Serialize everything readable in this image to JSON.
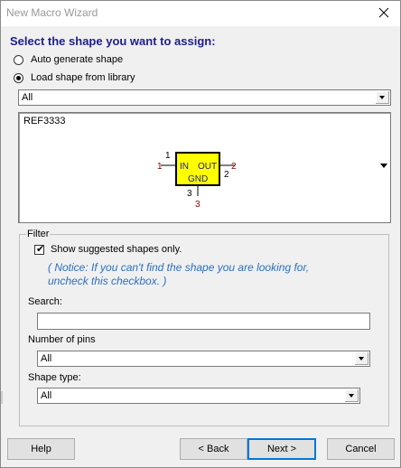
{
  "window": {
    "title": "New Macro Wizard"
  },
  "heading": "Select the shape you want to assign:",
  "options": {
    "auto": "Auto generate shape",
    "library": "Load shape from library",
    "selected": "library"
  },
  "library_combo": {
    "value": "All"
  },
  "preview": {
    "shape_name": "REF3333",
    "symbol": {
      "pins": [
        {
          "number": "1",
          "name": "IN"
        },
        {
          "number": "2",
          "name": "OUT"
        },
        {
          "number": "3",
          "name": "GND"
        }
      ],
      "body_color": "#ffff00",
      "pin_number_color": "#8b0000"
    }
  },
  "filter": {
    "legend": "Filter",
    "suggested_label": "Show suggested shapes only.",
    "suggested_checked": true,
    "notice": "( Notice: If you can't find the shape you are looking for, uncheck this checkbox. )",
    "search_label": "Search:",
    "search_value": "",
    "pins_label": "Number of pins",
    "pins_value": "All",
    "type_label": "Shape type:",
    "type_value": "All"
  },
  "buttons": {
    "help": "Help",
    "back": "< Back",
    "next": "Next >",
    "cancel": "Cancel"
  },
  "colors": {
    "heading": "#1e1e8c",
    "notice": "#2a6fc1",
    "default_button_border": "#0078d7"
  }
}
